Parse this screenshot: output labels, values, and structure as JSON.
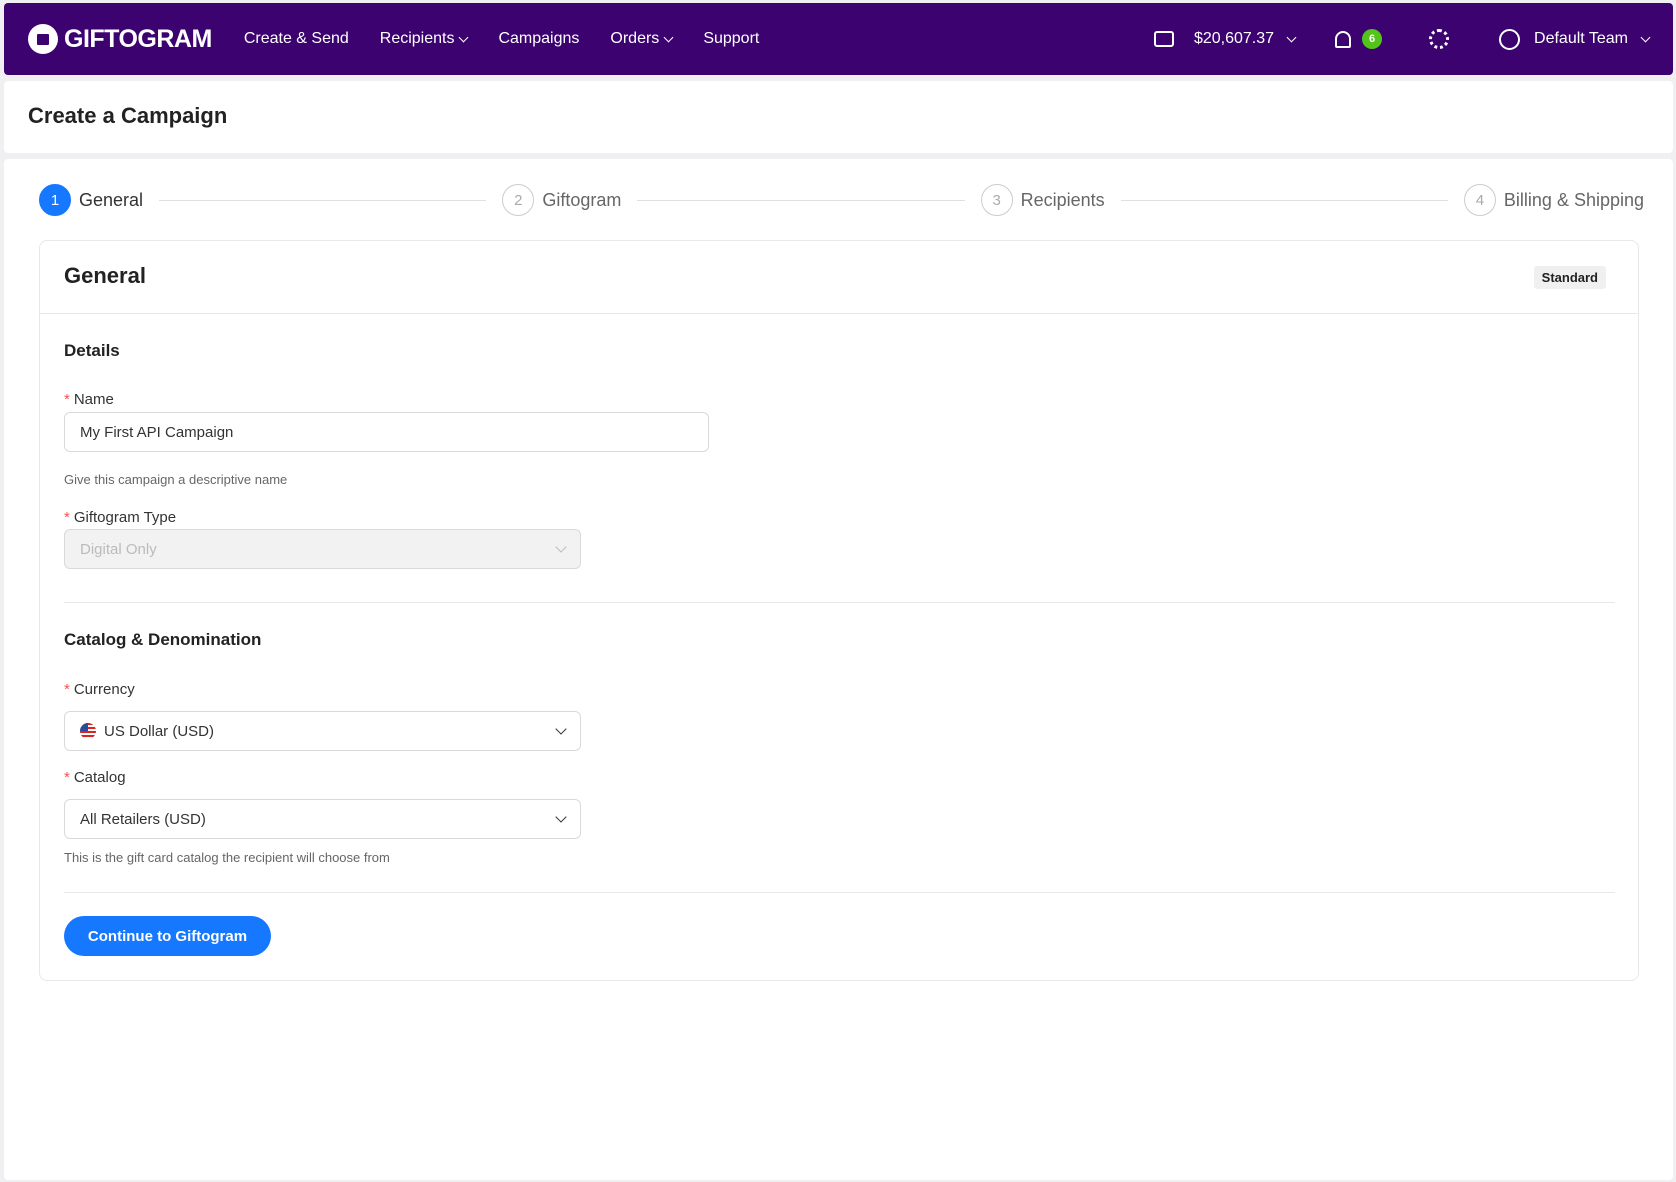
{
  "nav": {
    "logo": "GIFTOGRAM",
    "items": [
      {
        "label": "Create & Send",
        "dropdown": false
      },
      {
        "label": "Recipients",
        "dropdown": true
      },
      {
        "label": "Campaigns",
        "dropdown": false
      },
      {
        "label": "Orders",
        "dropdown": true
      },
      {
        "label": "Support",
        "dropdown": false
      }
    ],
    "balance": "$20,607.37",
    "notifications": "6",
    "team": "Default Team",
    "colors": {
      "bar": "#3c0370",
      "badge": "#52c41a"
    }
  },
  "page_title": "Create a Campaign",
  "steps": [
    {
      "num": "1",
      "label": "General",
      "active": true
    },
    {
      "num": "2",
      "label": "Giftogram"
    },
    {
      "num": "3",
      "label": "Recipients"
    },
    {
      "num": "4",
      "label": "Billing & Shipping"
    }
  ],
  "card": {
    "title": "General",
    "tag": "Standard",
    "details_heading": "Details",
    "name_label": "Name",
    "name_value": "My First API Campaign",
    "name_help": "Give this campaign a descriptive name",
    "type_label": "Giftogram Type",
    "type_value": "Digital Only",
    "catalog_heading": "Catalog & Denomination",
    "currency_label": "Currency",
    "currency_value": "US Dollar (USD)",
    "catalog_label": "Catalog",
    "catalog_value": "All Retailers (USD)",
    "catalog_help": "This is the gift card catalog the recipient will choose from",
    "continue_button": "Continue to Giftogram",
    "accent": "#1677ff"
  }
}
